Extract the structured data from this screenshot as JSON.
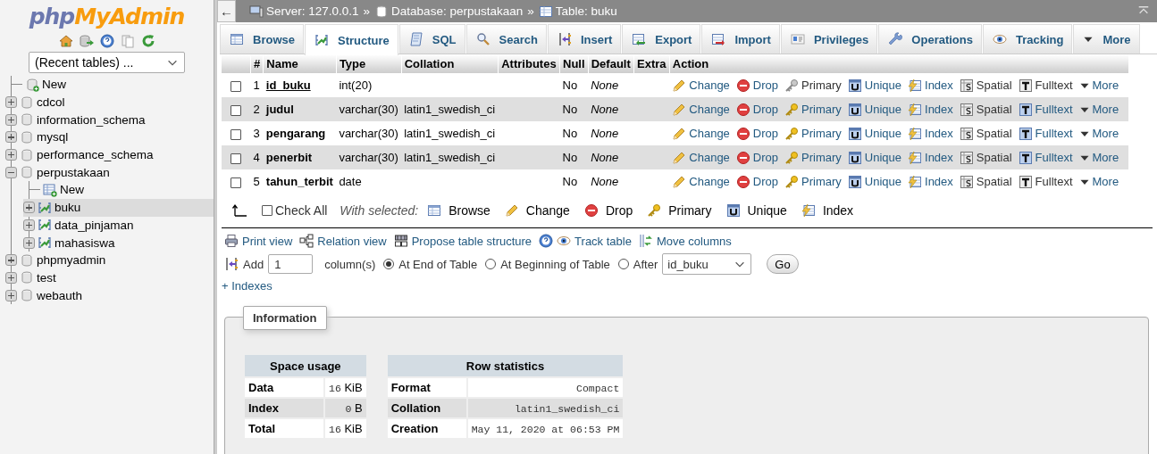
{
  "sidebar": {
    "logo": {
      "php": "php",
      "brand": "MyAdmin"
    },
    "recent_tables": "(Recent tables) ...",
    "tree": [
      {
        "label": "New",
        "kind": "new",
        "selected": false
      },
      {
        "label": "cdcol",
        "kind": "database",
        "expanded": false,
        "selected": false
      },
      {
        "label": "information_schema",
        "kind": "database",
        "expanded": false,
        "selected": false
      },
      {
        "label": "mysql",
        "kind": "database",
        "expanded": false,
        "selected": false
      },
      {
        "label": "performance_schema",
        "kind": "database",
        "expanded": false,
        "selected": false
      },
      {
        "label": "perpustakaan",
        "kind": "database",
        "expanded": true,
        "selected": false,
        "children": [
          {
            "label": "New",
            "kind": "new",
            "selected": false
          },
          {
            "label": "buku",
            "kind": "table",
            "expanded": false,
            "selected": true
          },
          {
            "label": "data_pinjaman",
            "kind": "table",
            "expanded": false,
            "selected": false
          },
          {
            "label": "mahasiswa",
            "kind": "table",
            "expanded": false,
            "selected": false
          }
        ]
      },
      {
        "label": "phpmyadmin",
        "kind": "database",
        "expanded": false,
        "selected": false
      },
      {
        "label": "test",
        "kind": "database",
        "expanded": false,
        "selected": false
      },
      {
        "label": "webauth",
        "kind": "database",
        "expanded": false,
        "selected": false
      }
    ]
  },
  "topbar": {
    "back": "←",
    "breadcrumb": [
      {
        "text": "Server: 127.0.0.1",
        "kind": "server"
      },
      {
        "text": "»",
        "kind": "separator"
      },
      {
        "text": "Database: perpustakaan",
        "kind": "database"
      },
      {
        "text": "»",
        "kind": "separator"
      },
      {
        "text": "Table: buku",
        "kind": "table"
      }
    ]
  },
  "tabs": [
    {
      "label": "Browse",
      "kind": "browse",
      "selected": false
    },
    {
      "label": "Structure",
      "kind": "structure",
      "selected": true
    },
    {
      "label": "SQL",
      "kind": "sql",
      "selected": false
    },
    {
      "label": "Search",
      "kind": "search",
      "selected": false
    },
    {
      "label": "Insert",
      "kind": "insert",
      "selected": false
    },
    {
      "label": "Export",
      "kind": "export",
      "selected": false
    },
    {
      "label": "Import",
      "kind": "import",
      "selected": false
    },
    {
      "label": "Privileges",
      "kind": "privileges",
      "selected": false
    },
    {
      "label": "Operations",
      "kind": "operations",
      "selected": false
    },
    {
      "label": "Tracking",
      "kind": "tracking",
      "selected": false
    },
    {
      "label": "More",
      "kind": "more",
      "selected": false
    }
  ],
  "table": {
    "columns": [
      "#",
      "Name",
      "Type",
      "Collation",
      "Attributes",
      "Null",
      "Default",
      "Extra",
      "Action"
    ],
    "rows": [
      {
        "num": "1",
        "name": "id_buku",
        "primary_key": true,
        "type": "int(20)",
        "collation": "",
        "null": "No",
        "default": "None",
        "checked": false,
        "actions": [
          {
            "label": "Change",
            "kind": "change",
            "disabled": false
          },
          {
            "label": "Drop",
            "kind": "drop",
            "disabled": false
          },
          {
            "label": "Primary",
            "kind": "primary",
            "disabled": true
          },
          {
            "label": "Unique",
            "kind": "unique",
            "disabled": false
          },
          {
            "label": "Index",
            "kind": "index",
            "disabled": false
          },
          {
            "label": "Spatial",
            "kind": "spatial",
            "disabled": true
          },
          {
            "label": "Fulltext",
            "kind": "fulltext",
            "disabled": true
          },
          {
            "label": "More",
            "kind": "more",
            "disabled": false
          }
        ]
      },
      {
        "num": "2",
        "name": "judul",
        "primary_key": false,
        "type": "varchar(30)",
        "collation": "latin1_swedish_ci",
        "null": "No",
        "default": "None",
        "checked": false,
        "actions": [
          {
            "label": "Change",
            "kind": "change",
            "disabled": false
          },
          {
            "label": "Drop",
            "kind": "drop",
            "disabled": false
          },
          {
            "label": "Primary",
            "kind": "primary",
            "disabled": false
          },
          {
            "label": "Unique",
            "kind": "unique",
            "disabled": false
          },
          {
            "label": "Index",
            "kind": "index",
            "disabled": false
          },
          {
            "label": "Spatial",
            "kind": "spatial",
            "disabled": true
          },
          {
            "label": "Fulltext",
            "kind": "fulltext",
            "disabled": false
          },
          {
            "label": "More",
            "kind": "more",
            "disabled": false
          }
        ]
      },
      {
        "num": "3",
        "name": "pengarang",
        "primary_key": false,
        "type": "varchar(30)",
        "collation": "latin1_swedish_ci",
        "null": "No",
        "default": "None",
        "checked": false,
        "actions": [
          {
            "label": "Change",
            "kind": "change",
            "disabled": false
          },
          {
            "label": "Drop",
            "kind": "drop",
            "disabled": false
          },
          {
            "label": "Primary",
            "kind": "primary",
            "disabled": false
          },
          {
            "label": "Unique",
            "kind": "unique",
            "disabled": false
          },
          {
            "label": "Index",
            "kind": "index",
            "disabled": false
          },
          {
            "label": "Spatial",
            "kind": "spatial",
            "disabled": true
          },
          {
            "label": "Fulltext",
            "kind": "fulltext",
            "disabled": false
          },
          {
            "label": "More",
            "kind": "more",
            "disabled": false
          }
        ]
      },
      {
        "num": "4",
        "name": "penerbit",
        "primary_key": false,
        "type": "varchar(30)",
        "collation": "latin1_swedish_ci",
        "null": "No",
        "default": "None",
        "checked": false,
        "actions": [
          {
            "label": "Change",
            "kind": "change",
            "disabled": false
          },
          {
            "label": "Drop",
            "kind": "drop",
            "disabled": false
          },
          {
            "label": "Primary",
            "kind": "primary",
            "disabled": false
          },
          {
            "label": "Unique",
            "kind": "unique",
            "disabled": false
          },
          {
            "label": "Index",
            "kind": "index",
            "disabled": false
          },
          {
            "label": "Spatial",
            "kind": "spatial",
            "disabled": true
          },
          {
            "label": "Fulltext",
            "kind": "fulltext",
            "disabled": false
          },
          {
            "label": "More",
            "kind": "more",
            "disabled": false
          }
        ]
      },
      {
        "num": "5",
        "name": "tahun_terbit",
        "primary_key": false,
        "type": "date",
        "collation": "",
        "null": "No",
        "default": "None",
        "checked": false,
        "actions": [
          {
            "label": "Change",
            "kind": "change",
            "disabled": false
          },
          {
            "label": "Drop",
            "kind": "drop",
            "disabled": false
          },
          {
            "label": "Primary",
            "kind": "primary",
            "disabled": false
          },
          {
            "label": "Unique",
            "kind": "unique",
            "disabled": false
          },
          {
            "label": "Index",
            "kind": "index",
            "disabled": false
          },
          {
            "label": "Spatial",
            "kind": "spatial",
            "disabled": true
          },
          {
            "label": "Fulltext",
            "kind": "fulltext",
            "disabled": true
          },
          {
            "label": "More",
            "kind": "more",
            "disabled": false
          }
        ]
      }
    ]
  },
  "bulk": {
    "check_all": {
      "label": "Check All",
      "checked": false
    },
    "with_selected": "With selected:",
    "buttons": [
      {
        "label": "Browse",
        "kind": "browse"
      },
      {
        "label": "Change",
        "kind": "change"
      },
      {
        "label": "Drop",
        "kind": "drop"
      },
      {
        "label": "Primary",
        "kind": "primary"
      },
      {
        "label": "Unique",
        "kind": "unique"
      },
      {
        "label": "Index",
        "kind": "index"
      }
    ]
  },
  "links": [
    {
      "label": "Print view",
      "kind": "print"
    },
    {
      "label": "Relation view",
      "kind": "relation"
    },
    {
      "label": "Propose table structure",
      "kind": "propose"
    },
    {
      "label": "Track table",
      "kind": "track"
    },
    {
      "label": "Move columns",
      "kind": "move"
    }
  ],
  "add_column": {
    "label": "Add",
    "count": "1",
    "unit": "column(s)",
    "positions": [
      {
        "label": "At End of Table",
        "selected": true
      },
      {
        "label": "At Beginning of Table",
        "selected": false
      },
      {
        "label": "After",
        "selected": false
      }
    ],
    "after_field": "id_buku",
    "go": "Go"
  },
  "indexes_link": "+ Indexes",
  "information": {
    "legend": "Information",
    "space_usage": {
      "title": "Space usage",
      "rows": [
        {
          "label": "Data",
          "value": "16",
          "unit": "KiB"
        },
        {
          "label": "Index",
          "value": "0",
          "unit": "B"
        },
        {
          "label": "Total",
          "value": "16",
          "unit": "KiB"
        }
      ]
    },
    "row_statistics": {
      "title": "Row statistics",
      "rows": [
        {
          "label": "Format",
          "value": "Compact"
        },
        {
          "label": "Collation",
          "value": "latin1_swedish_ci"
        },
        {
          "label": "Creation",
          "value": "May 11, 2020 at 06:53 PM"
        }
      ]
    }
  }
}
